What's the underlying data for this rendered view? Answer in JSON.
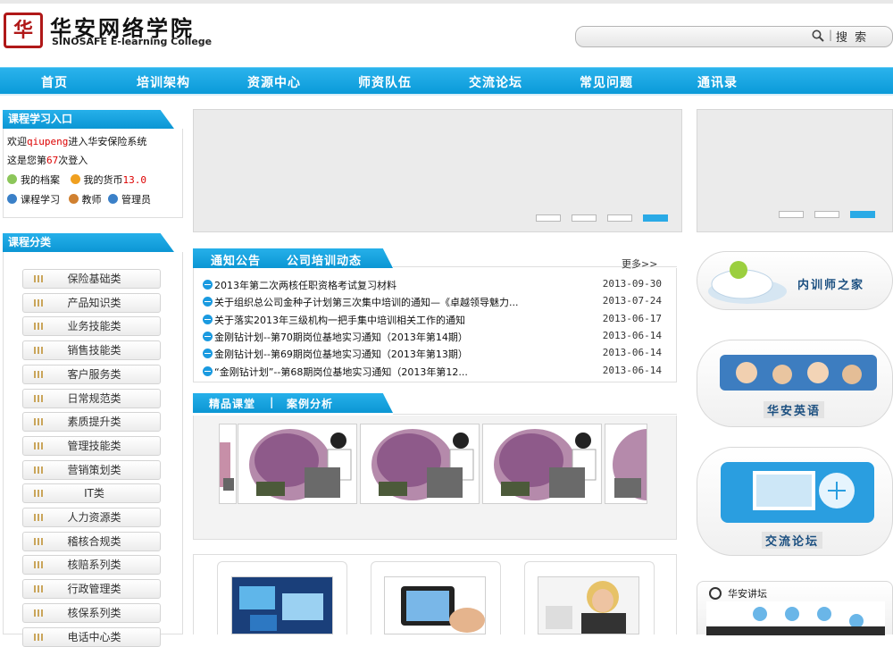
{
  "header": {
    "logo_mark": "华",
    "title": "华安网络学院",
    "subtitle": "SINOSAFE E-learning College",
    "search_button": "搜 索",
    "search_sep": "|"
  },
  "nav": [
    "首页",
    "培训架构",
    "资源中心",
    "师资队伍",
    "交流论坛",
    "常见问题",
    "通讯录"
  ],
  "login": {
    "heading": "课程学习入口",
    "welcome_prefix": "欢迎",
    "username": "qiupeng",
    "welcome_suffix": "进入华安保险系统",
    "visits_prefix": "这是您第",
    "visits": "67",
    "visits_suffix": "次登入",
    "my_profile": "我的档案",
    "my_currency_label": "我的货币",
    "my_currency_value": "13.0",
    "course_study": "课程学习",
    "teacher": "教师",
    "admin": "管理员"
  },
  "categories": {
    "heading": "课程分类",
    "items": [
      "保险基础类",
      "产品知识类",
      "业务技能类",
      "销售技能类",
      "客户服务类",
      "日常规范类",
      "素质提升类",
      "管理技能类",
      "营销策划类",
      "IT类",
      "人力资源类",
      "稽核合规类",
      "核赔系列类",
      "行政管理类",
      "核保系列类",
      "电话中心类"
    ]
  },
  "banner": {
    "dots": 4,
    "active": 4
  },
  "right_banner": {
    "dots": 3,
    "active": 3
  },
  "notices": {
    "tab1": "通知公告",
    "tab2": "公司培训动态",
    "more": "更多>>",
    "items": [
      {
        "title": "2013年第二次两核任职资格考试复习材料",
        "date": "2013-09-30"
      },
      {
        "title": "关于组织总公司金种子计划第三次集中培训的通知—《卓越领导魅力...",
        "date": "2013-07-24"
      },
      {
        "title": "关于落实2013年三级机构一把手集中培训相关工作的通知",
        "date": "2013-06-17"
      },
      {
        "title": "金刚钻计划--第70期岗位基地实习通知（2013年第14期）",
        "date": "2013-06-14"
      },
      {
        "title": "金刚钻计划--第69期岗位基地实习通知（2013年第13期）",
        "date": "2013-06-14"
      },
      {
        "title": "“金刚钻计划”--第68期岗位基地实习通知（2013年第12...",
        "date": "2013-06-14"
      }
    ]
  },
  "courses": {
    "tab1": "精品课堂",
    "sep": "|",
    "tab2": "案例分析"
  },
  "right": {
    "trainer_home": "内训师之家",
    "english": "华安英语",
    "forum": "交流论坛",
    "lecture": "华安讲坛"
  },
  "colors": {
    "nav": "#0a9ad9",
    "accent_red": "#d00000",
    "logo": "#b01818"
  }
}
